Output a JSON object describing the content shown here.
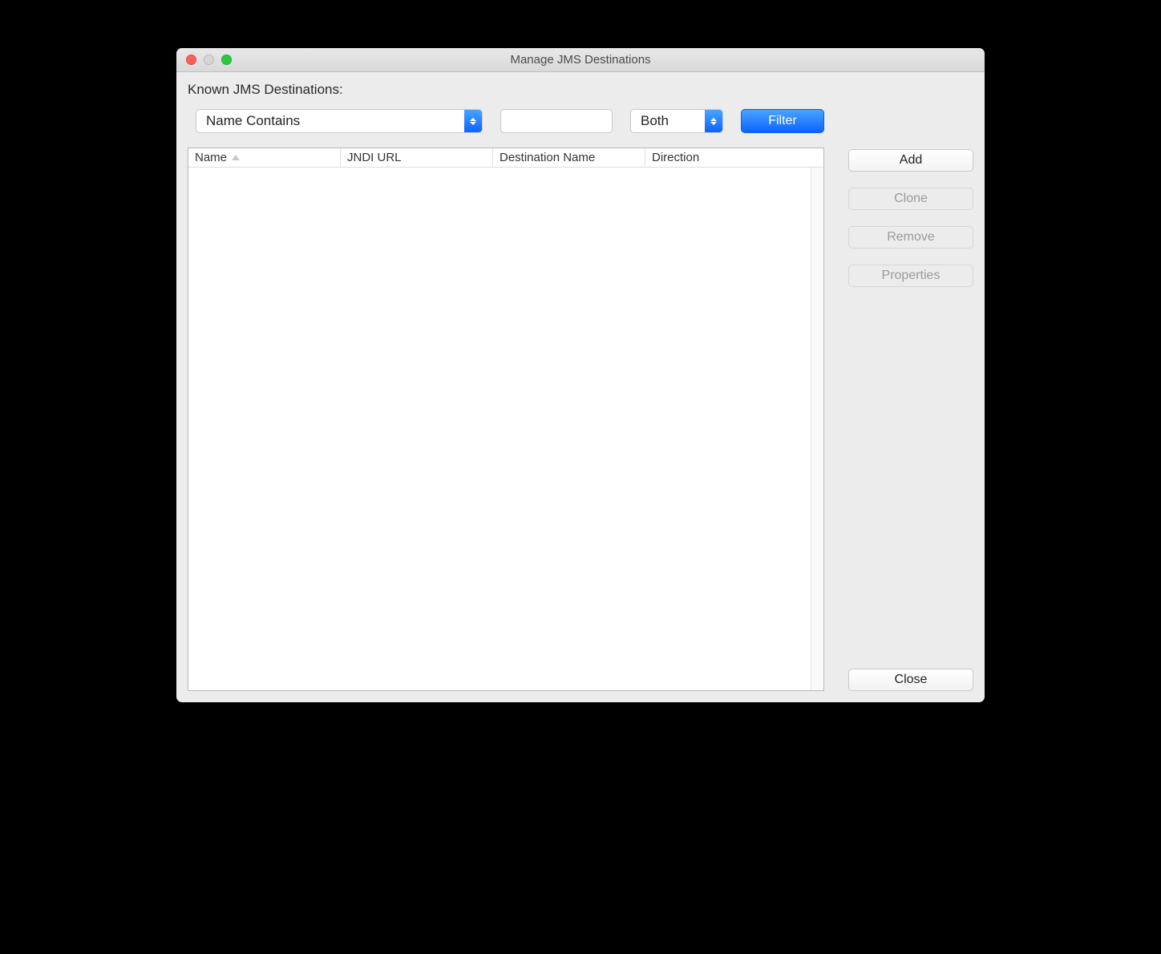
{
  "window": {
    "title": "Manage JMS Destinations"
  },
  "section": {
    "label": "Known JMS Destinations:"
  },
  "filter": {
    "mode_selected": "Name Contains",
    "text_value": "",
    "direction_selected": "Both",
    "button_label": "Filter"
  },
  "table": {
    "columns": [
      "Name",
      "JNDI URL",
      "Destination Name",
      "Direction"
    ],
    "sort_column": "Name",
    "sort_direction": "asc",
    "rows": []
  },
  "buttons": {
    "add": "Add",
    "clone": "Clone",
    "remove": "Remove",
    "properties": "Properties",
    "close": "Close"
  }
}
